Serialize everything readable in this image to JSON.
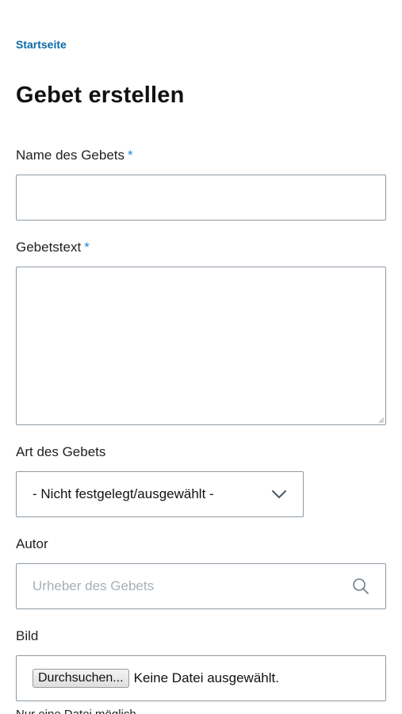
{
  "breadcrumb": {
    "home_label": "Startseite"
  },
  "page": {
    "title": "Gebet erstellen"
  },
  "form": {
    "name_label": "Name des Gebets",
    "required_marker": "*",
    "name_value": "",
    "text_label": "Gebetstext",
    "text_value": "",
    "type_label": "Art des Gebets",
    "type_selected": "- Nicht festgelegt/ausgewählt -",
    "author_label": "Autor",
    "author_placeholder": "Urheber des Gebets",
    "image_label": "Bild",
    "file_button": "Durchsuchen...",
    "file_status": "Keine Datei ausgewählt.",
    "file_hint": "Nur eine Datei möglich."
  },
  "icons": {
    "select": "chevron-down-icon",
    "author": "search-icon",
    "textarea": "resize-handle-icon"
  },
  "colors": {
    "link": "#0a6aa8",
    "required": "#2a86c8",
    "border": "#8e9aa4",
    "placeholder": "#a7afb6"
  }
}
